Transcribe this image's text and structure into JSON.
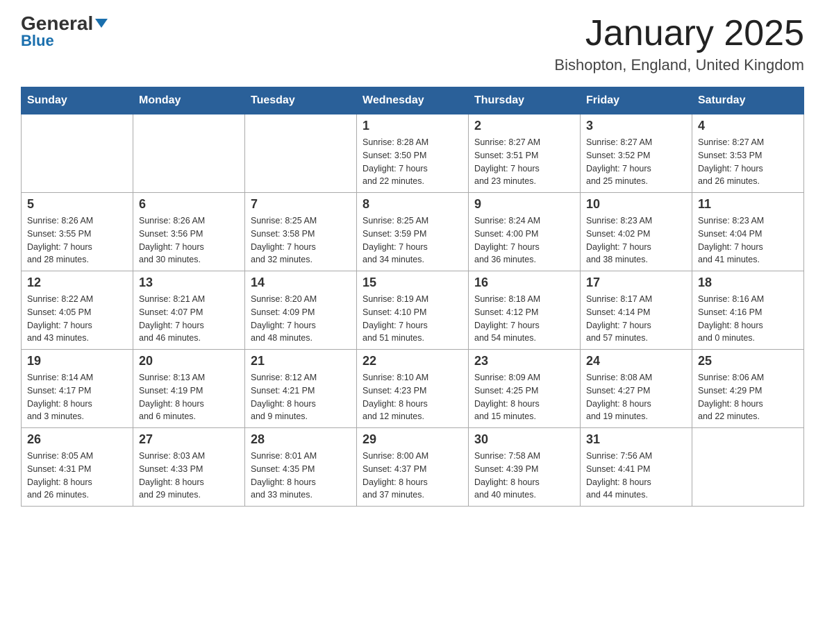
{
  "header": {
    "logo_main": "General",
    "logo_sub": "Blue",
    "month_year": "January 2025",
    "location": "Bishopton, England, United Kingdom"
  },
  "days_of_week": [
    "Sunday",
    "Monday",
    "Tuesday",
    "Wednesday",
    "Thursday",
    "Friday",
    "Saturday"
  ],
  "weeks": [
    [
      {
        "day": "",
        "info": ""
      },
      {
        "day": "",
        "info": ""
      },
      {
        "day": "",
        "info": ""
      },
      {
        "day": "1",
        "info": "Sunrise: 8:28 AM\nSunset: 3:50 PM\nDaylight: 7 hours\nand 22 minutes."
      },
      {
        "day": "2",
        "info": "Sunrise: 8:27 AM\nSunset: 3:51 PM\nDaylight: 7 hours\nand 23 minutes."
      },
      {
        "day": "3",
        "info": "Sunrise: 8:27 AM\nSunset: 3:52 PM\nDaylight: 7 hours\nand 25 minutes."
      },
      {
        "day": "4",
        "info": "Sunrise: 8:27 AM\nSunset: 3:53 PM\nDaylight: 7 hours\nand 26 minutes."
      }
    ],
    [
      {
        "day": "5",
        "info": "Sunrise: 8:26 AM\nSunset: 3:55 PM\nDaylight: 7 hours\nand 28 minutes."
      },
      {
        "day": "6",
        "info": "Sunrise: 8:26 AM\nSunset: 3:56 PM\nDaylight: 7 hours\nand 30 minutes."
      },
      {
        "day": "7",
        "info": "Sunrise: 8:25 AM\nSunset: 3:58 PM\nDaylight: 7 hours\nand 32 minutes."
      },
      {
        "day": "8",
        "info": "Sunrise: 8:25 AM\nSunset: 3:59 PM\nDaylight: 7 hours\nand 34 minutes."
      },
      {
        "day": "9",
        "info": "Sunrise: 8:24 AM\nSunset: 4:00 PM\nDaylight: 7 hours\nand 36 minutes."
      },
      {
        "day": "10",
        "info": "Sunrise: 8:23 AM\nSunset: 4:02 PM\nDaylight: 7 hours\nand 38 minutes."
      },
      {
        "day": "11",
        "info": "Sunrise: 8:23 AM\nSunset: 4:04 PM\nDaylight: 7 hours\nand 41 minutes."
      }
    ],
    [
      {
        "day": "12",
        "info": "Sunrise: 8:22 AM\nSunset: 4:05 PM\nDaylight: 7 hours\nand 43 minutes."
      },
      {
        "day": "13",
        "info": "Sunrise: 8:21 AM\nSunset: 4:07 PM\nDaylight: 7 hours\nand 46 minutes."
      },
      {
        "day": "14",
        "info": "Sunrise: 8:20 AM\nSunset: 4:09 PM\nDaylight: 7 hours\nand 48 minutes."
      },
      {
        "day": "15",
        "info": "Sunrise: 8:19 AM\nSunset: 4:10 PM\nDaylight: 7 hours\nand 51 minutes."
      },
      {
        "day": "16",
        "info": "Sunrise: 8:18 AM\nSunset: 4:12 PM\nDaylight: 7 hours\nand 54 minutes."
      },
      {
        "day": "17",
        "info": "Sunrise: 8:17 AM\nSunset: 4:14 PM\nDaylight: 7 hours\nand 57 minutes."
      },
      {
        "day": "18",
        "info": "Sunrise: 8:16 AM\nSunset: 4:16 PM\nDaylight: 8 hours\nand 0 minutes."
      }
    ],
    [
      {
        "day": "19",
        "info": "Sunrise: 8:14 AM\nSunset: 4:17 PM\nDaylight: 8 hours\nand 3 minutes."
      },
      {
        "day": "20",
        "info": "Sunrise: 8:13 AM\nSunset: 4:19 PM\nDaylight: 8 hours\nand 6 minutes."
      },
      {
        "day": "21",
        "info": "Sunrise: 8:12 AM\nSunset: 4:21 PM\nDaylight: 8 hours\nand 9 minutes."
      },
      {
        "day": "22",
        "info": "Sunrise: 8:10 AM\nSunset: 4:23 PM\nDaylight: 8 hours\nand 12 minutes."
      },
      {
        "day": "23",
        "info": "Sunrise: 8:09 AM\nSunset: 4:25 PM\nDaylight: 8 hours\nand 15 minutes."
      },
      {
        "day": "24",
        "info": "Sunrise: 8:08 AM\nSunset: 4:27 PM\nDaylight: 8 hours\nand 19 minutes."
      },
      {
        "day": "25",
        "info": "Sunrise: 8:06 AM\nSunset: 4:29 PM\nDaylight: 8 hours\nand 22 minutes."
      }
    ],
    [
      {
        "day": "26",
        "info": "Sunrise: 8:05 AM\nSunset: 4:31 PM\nDaylight: 8 hours\nand 26 minutes."
      },
      {
        "day": "27",
        "info": "Sunrise: 8:03 AM\nSunset: 4:33 PM\nDaylight: 8 hours\nand 29 minutes."
      },
      {
        "day": "28",
        "info": "Sunrise: 8:01 AM\nSunset: 4:35 PM\nDaylight: 8 hours\nand 33 minutes."
      },
      {
        "day": "29",
        "info": "Sunrise: 8:00 AM\nSunset: 4:37 PM\nDaylight: 8 hours\nand 37 minutes."
      },
      {
        "day": "30",
        "info": "Sunrise: 7:58 AM\nSunset: 4:39 PM\nDaylight: 8 hours\nand 40 minutes."
      },
      {
        "day": "31",
        "info": "Sunrise: 7:56 AM\nSunset: 4:41 PM\nDaylight: 8 hours\nand 44 minutes."
      },
      {
        "day": "",
        "info": ""
      }
    ]
  ]
}
